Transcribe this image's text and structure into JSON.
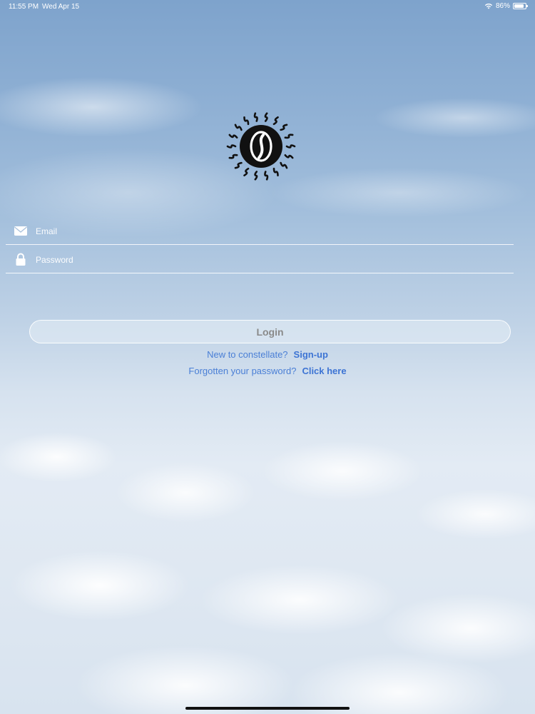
{
  "status_bar": {
    "time": "11:55 PM",
    "date": "Wed Apr 15",
    "battery_percent": "86%",
    "battery_level": 0.86,
    "wifi_icon": "wifi-icon",
    "battery_icon": "battery-icon",
    "text_color": "#ffffff"
  },
  "logo": {
    "icon": "sun-logo-icon"
  },
  "form": {
    "email": {
      "placeholder": "Email",
      "value": "",
      "icon": "envelope-icon"
    },
    "password": {
      "placeholder": "Password",
      "value": "",
      "icon": "lock-icon"
    }
  },
  "login_button": {
    "label": "Login"
  },
  "links": {
    "signup_prompt": "New to constellate?",
    "signup_action": "Sign-up",
    "forgot_prompt": "Forgotten your password?",
    "forgot_action": "Click here"
  },
  "colors": {
    "link": "#4a7fd6",
    "button_text": "#8a8a8a"
  }
}
